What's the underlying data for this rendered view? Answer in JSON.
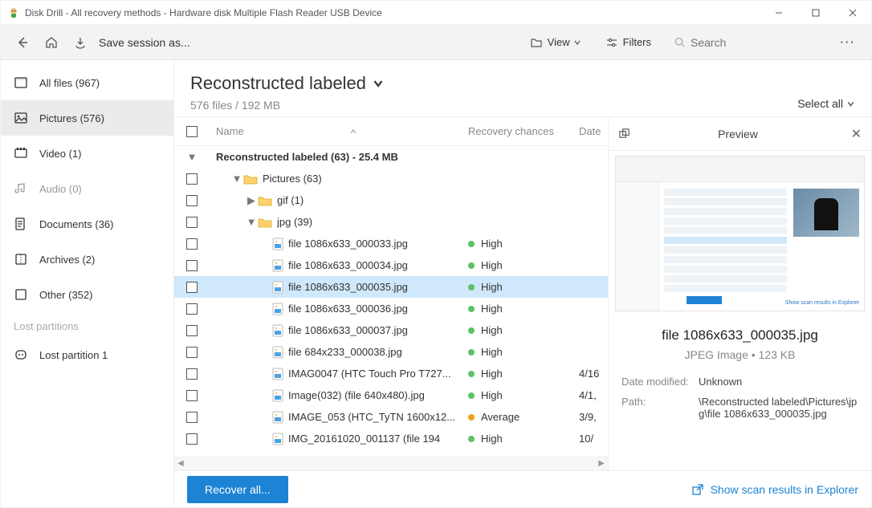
{
  "window": {
    "title": "Disk Drill - All recovery methods - Hardware disk Multiple Flash Reader USB Device"
  },
  "toolbar": {
    "save_session_label": "Save session as...",
    "view_label": "View",
    "filters_label": "Filters",
    "search_placeholder": "Search"
  },
  "sidebar": {
    "items": [
      {
        "label": "All files (967)",
        "dim": false,
        "active": false
      },
      {
        "label": "Pictures (576)",
        "dim": false,
        "active": true
      },
      {
        "label": "Video (1)",
        "dim": false,
        "active": false
      },
      {
        "label": "Audio (0)",
        "dim": true,
        "active": false
      },
      {
        "label": "Documents (36)",
        "dim": false,
        "active": false
      },
      {
        "label": "Archives (2)",
        "dim": false,
        "active": false
      },
      {
        "label": "Other (352)",
        "dim": false,
        "active": false
      }
    ],
    "lost_partitions_header": "Lost partitions",
    "lost_partitions": [
      {
        "label": "Lost partition 1"
      }
    ]
  },
  "content": {
    "title": "Reconstructed labeled",
    "subtitle": "576 files / 192 MB",
    "select_all_label": "Select all",
    "columns": {
      "name": "Name",
      "recovery": "Recovery chances",
      "date": "Date"
    },
    "group_header": "Reconstructed labeled (63) - 25.4 MB",
    "folders": [
      {
        "label": "Pictures (63)",
        "depth": 1,
        "expanded": true
      },
      {
        "label": "gif (1)",
        "depth": 2,
        "expanded": false
      },
      {
        "label": "jpg (39)",
        "depth": 2,
        "expanded": true
      }
    ],
    "files": [
      {
        "name": "file 1086x633_000033.jpg",
        "recovery": "High",
        "recovery_level": "high",
        "date": "",
        "selected": false
      },
      {
        "name": "file 1086x633_000034.jpg",
        "recovery": "High",
        "recovery_level": "high",
        "date": "",
        "selected": false
      },
      {
        "name": "file 1086x633_000035.jpg",
        "recovery": "High",
        "recovery_level": "high",
        "date": "",
        "selected": true
      },
      {
        "name": "file 1086x633_000036.jpg",
        "recovery": "High",
        "recovery_level": "high",
        "date": "",
        "selected": false
      },
      {
        "name": "file 1086x633_000037.jpg",
        "recovery": "High",
        "recovery_level": "high",
        "date": "",
        "selected": false
      },
      {
        "name": "file 684x233_000038.jpg",
        "recovery": "High",
        "recovery_level": "high",
        "date": "",
        "selected": false
      },
      {
        "name": "IMAG0047 (HTC Touch Pro T727...",
        "recovery": "High",
        "recovery_level": "high",
        "date": "4/16",
        "selected": false
      },
      {
        "name": "Image(032) (file 640x480).jpg",
        "recovery": "High",
        "recovery_level": "high",
        "date": "4/1,",
        "selected": false
      },
      {
        "name": "IMAGE_053 (HTC_TyTN 1600x12...",
        "recovery": "Average",
        "recovery_level": "avg",
        "date": "3/9,",
        "selected": false
      },
      {
        "name": "IMG_20161020_001137 (file 194",
        "recovery": "High",
        "recovery_level": "high",
        "date": "10/",
        "selected": false
      }
    ]
  },
  "preview": {
    "panel_title": "Preview",
    "filename": "file 1086x633_000035.jpg",
    "filetype": "JPEG Image • 123 KB",
    "fields": [
      {
        "label": "Date modified:",
        "value": "Unknown"
      },
      {
        "label": "Path:",
        "value": "\\Reconstructed labeled\\Pictures\\jpg\\file 1086x633_000035.jpg"
      }
    ]
  },
  "bottom": {
    "recover_label": "Recover all...",
    "explorer_label": "Show scan results in Explorer"
  }
}
